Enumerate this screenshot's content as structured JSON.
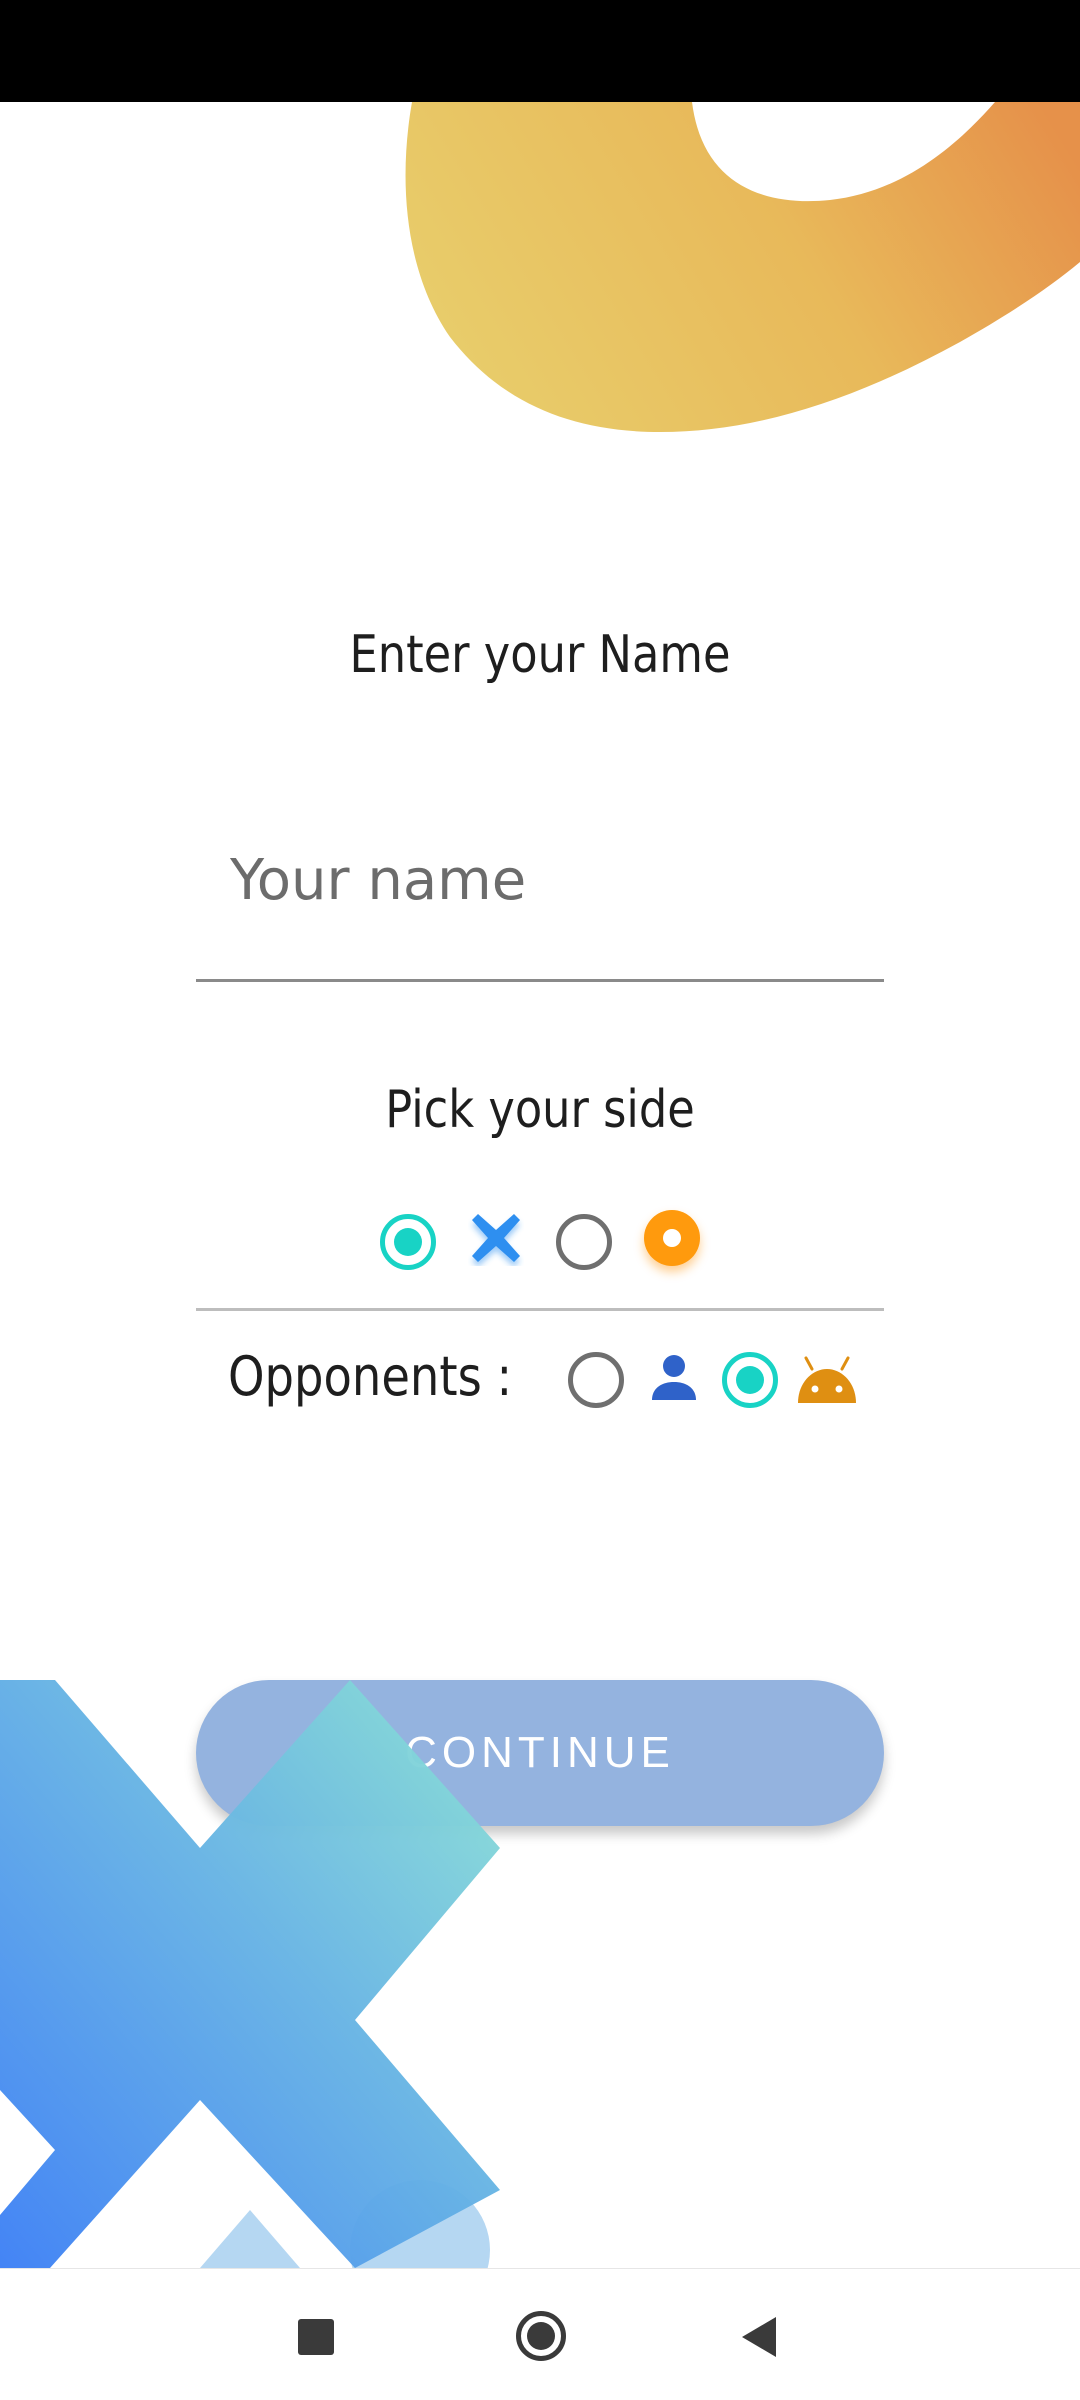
{
  "screen": {
    "enter_name_title": "Enter your Name",
    "name_placeholder": "Your name",
    "name_value": "",
    "pick_side_title": "Pick your side",
    "opponents_label": "Opponents :",
    "continue_label": "CONTINUE"
  },
  "side_options": [
    {
      "mark": "cross-icon",
      "selected": true
    },
    {
      "mark": "circle-icon",
      "selected": false
    }
  ],
  "opponent_options": [
    {
      "icon": "person-icon",
      "selected": false
    },
    {
      "icon": "android-icon",
      "selected": true
    }
  ],
  "colors": {
    "accent_teal": "#18d3c5",
    "cross_blue": "#2f8ff0",
    "circle_orange": "#ff9a0d",
    "person_blue": "#2f62c9",
    "android_orange": "#df8f12",
    "button_blue": "#94b3df"
  }
}
